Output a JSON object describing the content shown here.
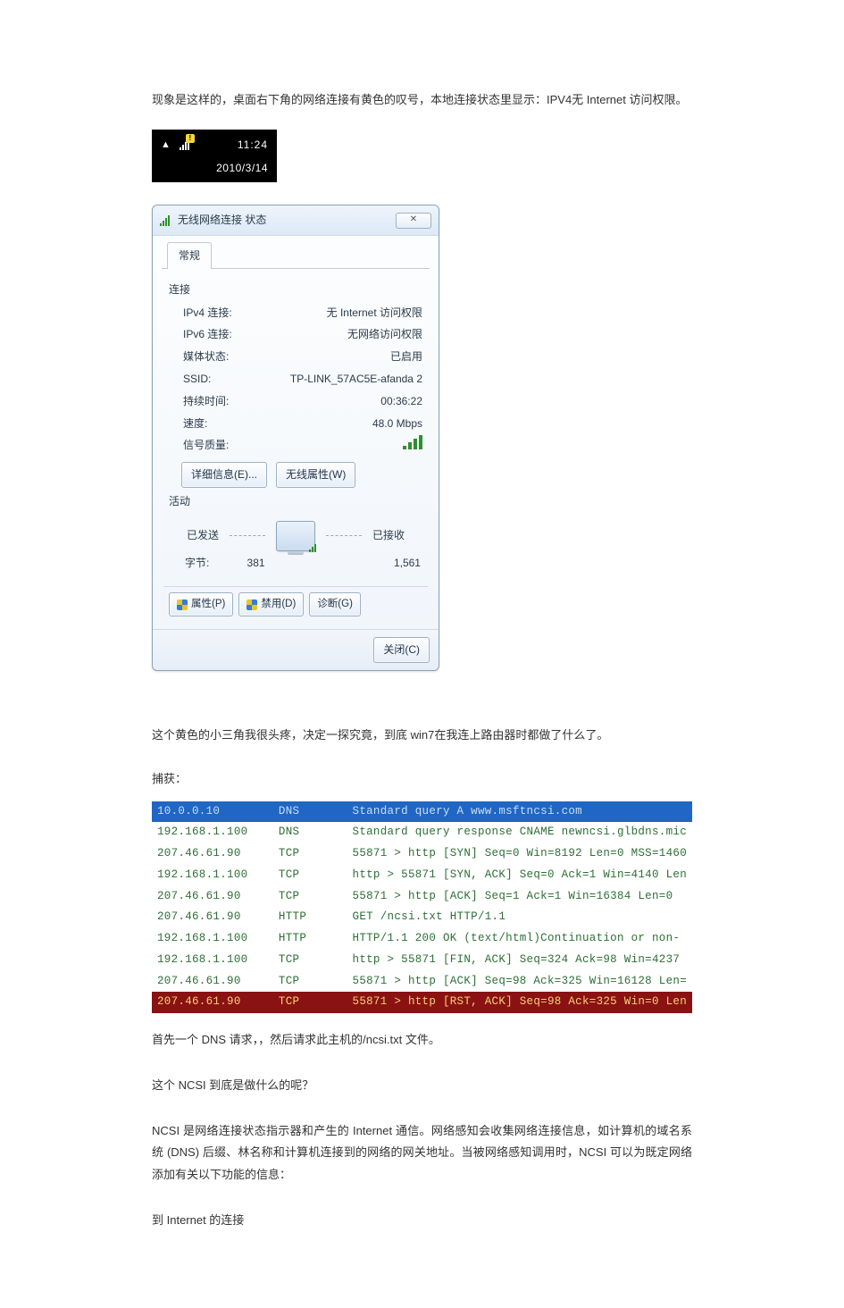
{
  "article": {
    "p1": "现象是这样的，桌面右下角的网络连接有黄色的叹号，本地连接状态里显示：IPV4无 Internet 访问权限。",
    "p2": "这个黄色的小三角我很头疼，决定一探究竟，到底 win7在我连上路由器时都做了什么了。",
    "p3": "捕获：",
    "p4": "首先一个 DNS 请求，，然后请求此主机的/ncsi.txt 文件。",
    "p5": "这个 NCSI 到底是做什么的呢？",
    "p6": "NCSI 是网络连接状态指示器和产生的 Internet 通信。网络感知会收集网络连接信息，如计算机的域名系统 (DNS) 后缀、林名称和计算机连接到的网络的网关地址。当被网络感知调用时，NCSI 可以为既定网络添加有关以下功能的信息：",
    "p7": "到 Internet 的连接"
  },
  "tray": {
    "time": "11:24",
    "date": "2010/3/14"
  },
  "dialog": {
    "title": "无线网络连接 状态",
    "close_x": "✕",
    "tab": "常规",
    "conn_label": "连接",
    "rows": {
      "ipv4_k": "IPv4 连接:",
      "ipv4_v": "无 Internet 访问权限",
      "ipv6_k": "IPv6 连接:",
      "ipv6_v": "无网络访问权限",
      "media_k": "媒体状态:",
      "media_v": "已启用",
      "ssid_k": "SSID:",
      "ssid_v": "TP-LINK_57AC5E-afanda 2",
      "dur_k": "持续时间:",
      "dur_v": "00:36:22",
      "speed_k": "速度:",
      "speed_v": "48.0 Mbps",
      "sigq_k": "信号质量:"
    },
    "btn_details": "详细信息(E)...",
    "btn_wprops": "无线属性(W)",
    "activity_label": "活动",
    "sent_label": "已发送",
    "recv_label": "已接收",
    "bytes_label": "字节:",
    "sent_bytes": "381",
    "recv_bytes": "1,561",
    "btn_props": "属性(P)",
    "btn_disable": "禁用(D)",
    "btn_diag": "诊断(G)",
    "btn_close": "关闭(C)"
  },
  "capture": [
    {
      "cls": "sel",
      "ip": "10.0.0.10",
      "proto": "DNS",
      "info": "Standard query A www.msftncsi.com"
    },
    {
      "cls": "norm",
      "ip": "192.168.1.100",
      "proto": "DNS",
      "info": "Standard query response CNAME newncsi.glbdns.mic"
    },
    {
      "cls": "norm",
      "ip": "207.46.61.90",
      "proto": "TCP",
      "info": "55871 > http [SYN] Seq=0 Win=8192 Len=0 MSS=1460"
    },
    {
      "cls": "norm",
      "ip": "192.168.1.100",
      "proto": "TCP",
      "info": "http > 55871 [SYN, ACK] Seq=0 Ack=1 Win=4140 Len"
    },
    {
      "cls": "norm",
      "ip": "207.46.61.90",
      "proto": "TCP",
      "info": "55871 > http [ACK] Seq=1 Ack=1 Win=16384 Len=0"
    },
    {
      "cls": "norm",
      "ip": "207.46.61.90",
      "proto": "HTTP",
      "info": "GET /ncsi.txt HTTP/1.1"
    },
    {
      "cls": "norm",
      "ip": "192.168.1.100",
      "proto": "HTTP",
      "info": "HTTP/1.1 200 OK  (text/html)Continuation or non-"
    },
    {
      "cls": "norm",
      "ip": "192.168.1.100",
      "proto": "TCP",
      "info": "http > 55871 [FIN, ACK] Seq=324 Ack=98 Win=4237"
    },
    {
      "cls": "norm",
      "ip": "207.46.61.90",
      "proto": "TCP",
      "info": "55871 > http [ACK] Seq=98 Ack=325 Win=16128 Len="
    },
    {
      "cls": "rst",
      "ip": "207.46.61.90",
      "proto": "TCP",
      "info": "55871 > http [RST, ACK] Seq=98 Ack=325 Win=0 Len"
    }
  ]
}
